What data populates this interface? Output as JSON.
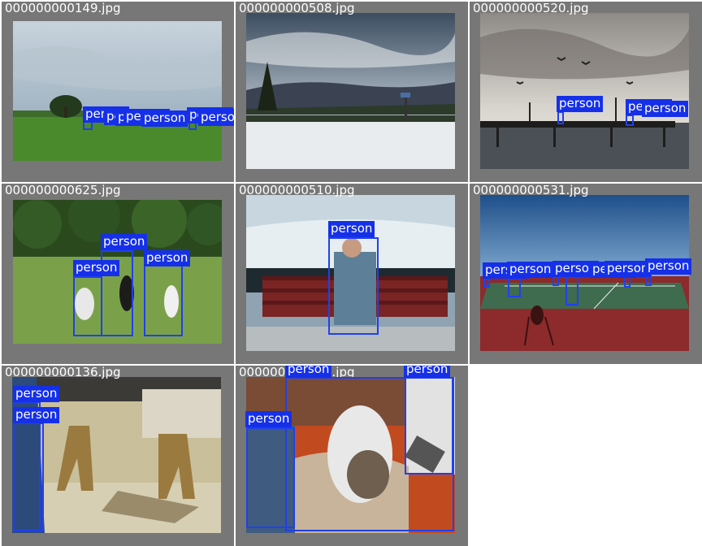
{
  "tiles": [
    {
      "filename": "000000000149.jpg",
      "labels": [
        "person",
        "person",
        "person",
        "person",
        "person",
        "person",
        "person",
        "person"
      ]
    },
    {
      "filename": "000000000508.jpg",
      "labels": []
    },
    {
      "filename": "000000000520.jpg",
      "labels": [
        "person",
        "person",
        "person"
      ]
    },
    {
      "filename": "000000000625.jpg",
      "labels": [
        "person",
        "person",
        "person"
      ]
    },
    {
      "filename": "000000000510.jpg",
      "labels": [
        "person"
      ]
    },
    {
      "filename": "000000000531.jpg",
      "labels": [
        "person",
        "person",
        "person",
        "person",
        "person",
        "person"
      ]
    },
    {
      "filename": "000000000136.jpg",
      "labels": [
        "person",
        "person"
      ]
    },
    {
      "filename": "000000000143.jpg",
      "labels": [
        "person",
        "person",
        "person"
      ]
    }
  ],
  "colors": {
    "tile_bg": "#777777",
    "box": "#2040ee",
    "label_bg": "#1530e8",
    "label_text": "#ffffff"
  }
}
